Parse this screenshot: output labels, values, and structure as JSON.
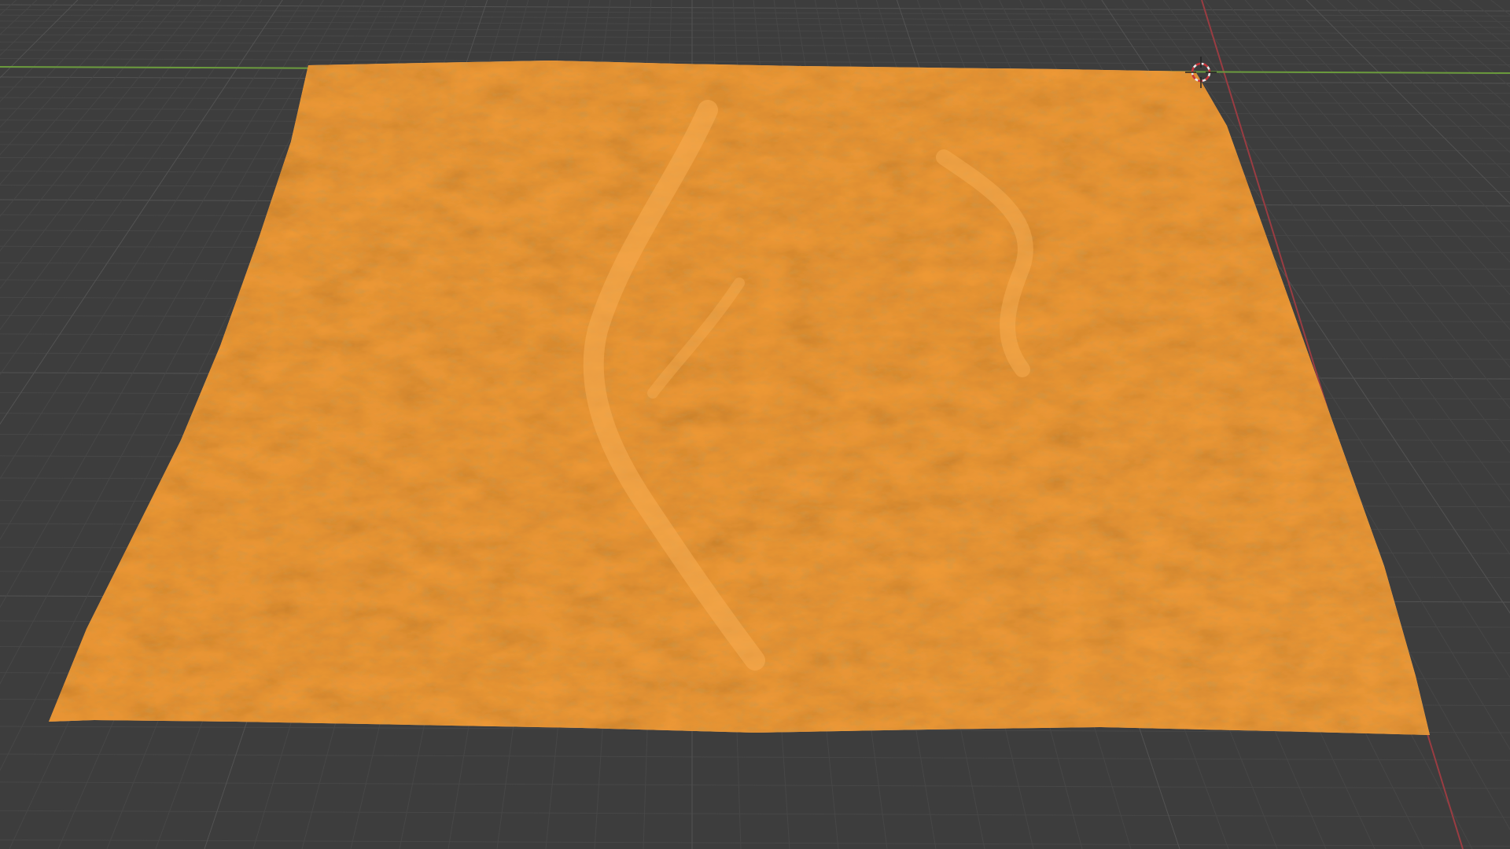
{
  "app": {
    "viewport_mode": "3D Viewport",
    "shading": "solid"
  },
  "colors": {
    "background": "#3d3d3d",
    "grid_minor": "#474747",
    "grid_major": "#535353",
    "axis_x": "#9a3c42",
    "axis_y": "#6a9a3c",
    "terrain_base": "#f09a36",
    "terrain_shadow": "#b86a1c",
    "terrain_highlight": "#ffc070"
  },
  "scene": {
    "object": "terrain-mesh",
    "cursor": "3d-cursor-icon"
  }
}
